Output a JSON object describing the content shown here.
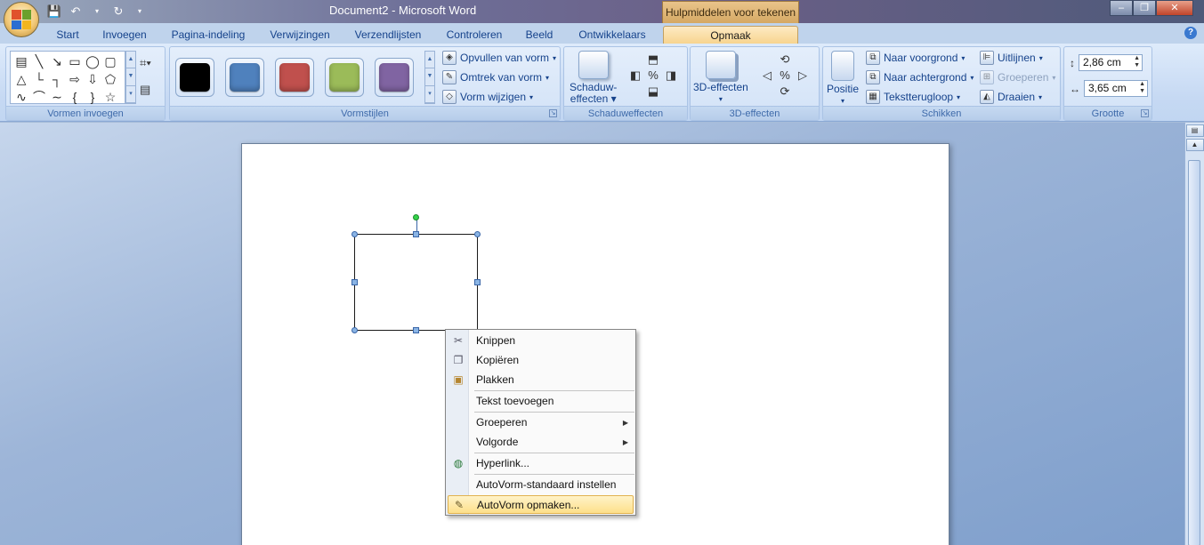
{
  "window": {
    "title": "Document2 - Microsoft Word",
    "context_tab_title": "Hulpmiddelen voor tekenen"
  },
  "tabs": [
    "Start",
    "Invoegen",
    "Pagina-indeling",
    "Verwijzingen",
    "Verzendlijsten",
    "Controleren",
    "Beeld",
    "Ontwikkelaars",
    "Opmaak"
  ],
  "active_tab": "Opmaak",
  "groups": {
    "insert_shapes": "Vormen invoegen",
    "shape_styles": "Vormstijlen",
    "shadow_effects": "Schaduweffecten",
    "effects_3d": "3D-effecten",
    "arrange": "Schikken",
    "size": "Grootte"
  },
  "shape_styles": {
    "swatch_colors": [
      "#000000",
      "#4f81bd",
      "#c0504d",
      "#9bbb59",
      "#8064a2"
    ],
    "fill": "Opvullen van vorm",
    "outline": "Omtrek van vorm",
    "change": "Vorm wijzigen"
  },
  "shadow": {
    "label_line1": "Schaduw-",
    "label_line2": "effecten"
  },
  "effects3d": {
    "label": "3D-effecten"
  },
  "arrange": {
    "position": "Positie",
    "bring_front": "Naar voorgrond",
    "send_back": "Naar achtergrond",
    "text_wrap": "Tekstterugloop",
    "align": "Uitlijnen",
    "group": "Groeperen",
    "rotate": "Draaien"
  },
  "size": {
    "height": "2,86 cm",
    "width": "3,65 cm"
  },
  "context_menu": {
    "items": [
      {
        "label": "Knippen",
        "icon": "scissors-icon",
        "glyph": "✂",
        "submenu": false
      },
      {
        "label": "Kopiëren",
        "icon": "copy-icon",
        "glyph": "❐",
        "submenu": false
      },
      {
        "label": "Plakken",
        "icon": "paste-icon",
        "glyph": "📋",
        "submenu": false
      },
      {
        "label": "Tekst toevoegen",
        "icon": "",
        "glyph": "",
        "submenu": false
      },
      {
        "label": "Groeperen",
        "icon": "",
        "glyph": "",
        "submenu": true
      },
      {
        "label": "Volgorde",
        "icon": "",
        "glyph": "",
        "submenu": true
      },
      {
        "label": "Hyperlink...",
        "icon": "globe-link-icon",
        "glyph": "🌐",
        "submenu": false
      },
      {
        "label": "AutoVorm-standaard instellen",
        "icon": "",
        "glyph": "",
        "submenu": false
      },
      {
        "label": "AutoVorm opmaken...",
        "icon": "format-shape-icon",
        "glyph": "✎",
        "submenu": false,
        "highlighted": true
      }
    ]
  }
}
